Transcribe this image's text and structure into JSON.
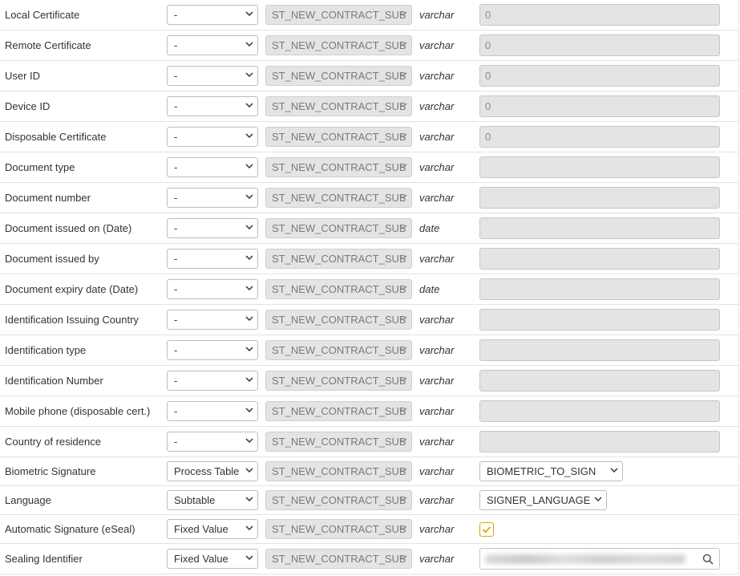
{
  "rows": [
    {
      "label": "Local Certificate",
      "mapping": "-",
      "source": "ST_NEW_CONTRACT_SUB",
      "type": "varchar",
      "value": "0"
    },
    {
      "label": "Remote Certificate",
      "mapping": "-",
      "source": "ST_NEW_CONTRACT_SUB",
      "type": "varchar",
      "value": "0"
    },
    {
      "label": "User ID",
      "mapping": "-",
      "source": "ST_NEW_CONTRACT_SUB",
      "type": "varchar",
      "value": "0"
    },
    {
      "label": "Device ID",
      "mapping": "-",
      "source": "ST_NEW_CONTRACT_SUB",
      "type": "varchar",
      "value": "0"
    },
    {
      "label": "Disposable Certificate",
      "mapping": "-",
      "source": "ST_NEW_CONTRACT_SUB",
      "type": "varchar",
      "value": "0"
    },
    {
      "label": "Document type",
      "mapping": "-",
      "source": "ST_NEW_CONTRACT_SUB",
      "type": "varchar",
      "value": ""
    },
    {
      "label": "Document number",
      "mapping": "-",
      "source": "ST_NEW_CONTRACT_SUB",
      "type": "varchar",
      "value": ""
    },
    {
      "label": "Document issued on (Date)",
      "mapping": "-",
      "source": "ST_NEW_CONTRACT_SUB",
      "type": "date",
      "value": ""
    },
    {
      "label": "Document issued by",
      "mapping": "-",
      "source": "ST_NEW_CONTRACT_SUB",
      "type": "varchar",
      "value": ""
    },
    {
      "label": "Document expiry date (Date)",
      "mapping": "-",
      "source": "ST_NEW_CONTRACT_SUB",
      "type": "date",
      "value": ""
    },
    {
      "label": "Identification Issuing Country",
      "mapping": "-",
      "source": "ST_NEW_CONTRACT_SUB",
      "type": "varchar",
      "value": ""
    },
    {
      "label": "Identification type",
      "mapping": "-",
      "source": "ST_NEW_CONTRACT_SUB",
      "type": "varchar",
      "value": ""
    },
    {
      "label": "Identification Number",
      "mapping": "-",
      "source": "ST_NEW_CONTRACT_SUB",
      "type": "varchar",
      "value": ""
    },
    {
      "label": "Mobile phone (disposable cert.)",
      "mapping": "-",
      "source": "ST_NEW_CONTRACT_SUB",
      "type": "varchar",
      "value": ""
    },
    {
      "label": "Country of residence",
      "mapping": "-",
      "source": "ST_NEW_CONTRACT_SUB",
      "type": "varchar",
      "value": ""
    },
    {
      "label": "Biometric Signature",
      "mapping": "Process Table",
      "source": "ST_NEW_CONTRACT_SUB",
      "type": "varchar",
      "value_select": "BIOMETRIC_TO_SIGN"
    },
    {
      "label": "Language",
      "mapping": "Subtable",
      "source": "ST_NEW_CONTRACT_SUB",
      "type": "varchar",
      "value_select": "SIGNER_LANGUAGE"
    },
    {
      "label": "Automatic Signature (eSeal)",
      "mapping": "Fixed Value",
      "source": "ST_NEW_CONTRACT_SUB",
      "type": "varchar",
      "checked": true
    },
    {
      "label": "Sealing Identifier",
      "mapping": "Fixed Value",
      "source": "ST_NEW_CONTRACT_SUB",
      "type": "varchar",
      "search_icon": "search-icon"
    }
  ],
  "colors": {
    "checkbox_accent": "#e0a40b",
    "disabled_bg": "#e4e4e4",
    "row_border": "#e3e3e3"
  }
}
